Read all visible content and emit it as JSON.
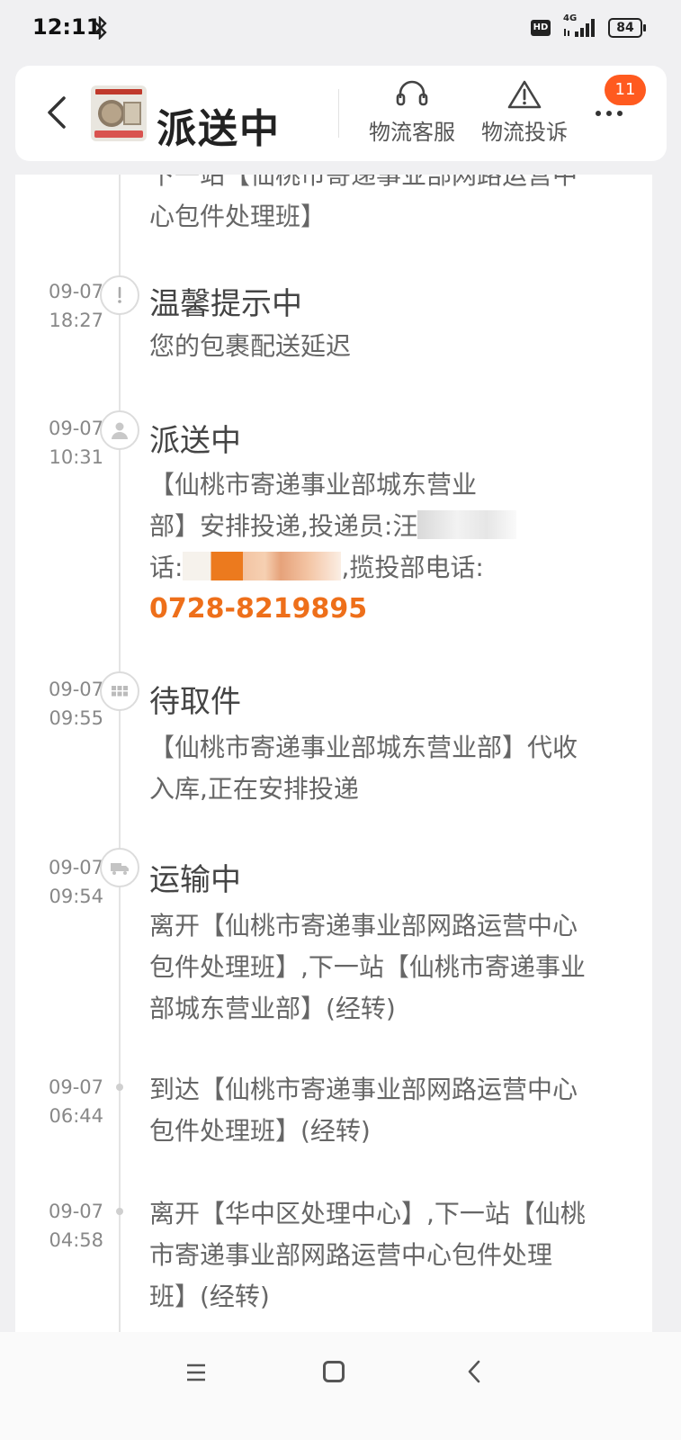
{
  "status_bar": {
    "time": "12:11",
    "network": "4G",
    "hd": "HD",
    "battery": "84"
  },
  "header": {
    "title": "派送中",
    "service_label": "物流客服",
    "complaint_label": "物流投诉",
    "badge_count": "11",
    "icons": [
      "back-arrow-icon",
      "headset-icon",
      "warning-triangle-icon",
      "more-dots-icon"
    ]
  },
  "timeline": {
    "partial_top": {
      "line1": "下一站【仙桃市寄递事业部网路运营中",
      "line2": "心包件处理班】"
    },
    "entries": [
      {
        "date": "09-07",
        "time": "18:27",
        "status": "温馨提示中",
        "desc": "您的包裹配送延迟",
        "icon": "exclamation-icon"
      },
      {
        "date": "09-07",
        "time": "10:31",
        "status": "派送中",
        "desc_line1": "【仙桃市寄递事业部城东营业",
        "desc_line2a": "部】安排投递,投递员:汪",
        "desc_line3a": "话:",
        "desc_line3b": ",揽投部电话:",
        "phone": "0728-8219895",
        "icon": "person-icon"
      },
      {
        "date": "09-07",
        "time": "09:55",
        "status": "待取件",
        "desc_line1": "【仙桃市寄递事业部城东营业部】代收",
        "desc_line2": "入库,正在安排投递",
        "icon": "grid-icon"
      },
      {
        "date": "09-07",
        "time": "09:54",
        "status": "运输中",
        "desc_line1": "离开【仙桃市寄递事业部网路运营中心",
        "desc_line2": "包件处理班】,下一站【仙桃市寄递事业",
        "desc_line3": "部城东营业部】(经转)",
        "icon": "truck-icon"
      },
      {
        "date": "09-07",
        "time": "06:44",
        "desc_line1": "到达【仙桃市寄递事业部网路运营中心",
        "desc_line2": "包件处理班】(经转)"
      },
      {
        "date": "09-07",
        "time": "04:58",
        "desc_line1": "离开【华中区处理中心】,下一站【仙桃",
        "desc_line2": "市寄递事业部网路运营中心包件处理",
        "desc_line3": "班】(经转)"
      }
    ]
  },
  "colors": {
    "accent": "#ee6f1a",
    "badge": "#ff5a1f"
  }
}
